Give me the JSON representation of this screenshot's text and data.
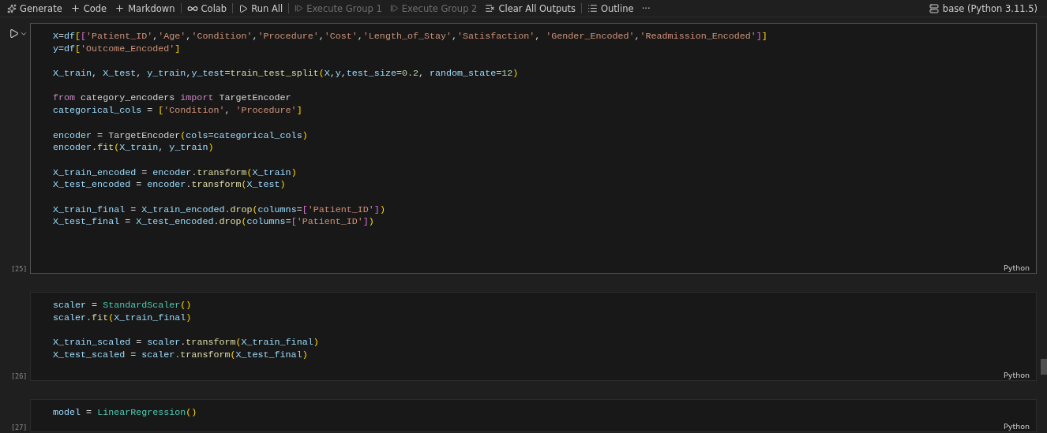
{
  "toolbar": {
    "items": [
      {
        "label": "Generate",
        "disabled": false,
        "separator_before": false
      },
      {
        "label": "Code",
        "disabled": false,
        "separator_before": false
      },
      {
        "label": "Markdown",
        "disabled": false,
        "separator_before": false
      },
      {
        "label": "Colab",
        "disabled": false,
        "separator_before": true
      },
      {
        "label": "Run All",
        "disabled": false,
        "separator_before": true
      },
      {
        "label": "Execute Group 1",
        "disabled": true,
        "separator_before": true
      },
      {
        "label": "Execute Group 2",
        "disabled": true,
        "separator_before": false
      },
      {
        "label": "Clear All Outputs",
        "disabled": false,
        "separator_before": false
      },
      {
        "label": "Outline",
        "disabled": false,
        "separator_before": true
      },
      {
        "label": "···",
        "disabled": false,
        "separator_before": false
      }
    ],
    "kernel": "base (Python 3.11.5)"
  },
  "cells": [
    {
      "focused": true,
      "execution_count": "[25]",
      "language": "Python",
      "blocks": [
        [
          [
            {
              "kind": "var",
              "text": "X"
            },
            {
              "kind": "op",
              "text": "="
            },
            {
              "kind": "var",
              "text": "df"
            },
            {
              "kind": "b1",
              "text": "["
            },
            {
              "kind": "b2",
              "text": "["
            },
            {
              "kind": "str",
              "text": "'Patient_ID'"
            },
            {
              "kind": "op",
              "text": ","
            },
            {
              "kind": "str",
              "text": "'Age'"
            },
            {
              "kind": "op",
              "text": ","
            },
            {
              "kind": "str",
              "text": "'Condition'"
            },
            {
              "kind": "op",
              "text": ","
            },
            {
              "kind": "str",
              "text": "'Procedure'"
            },
            {
              "kind": "op",
              "text": ","
            },
            {
              "kind": "str",
              "text": "'Cost'"
            },
            {
              "kind": "op",
              "text": ","
            },
            {
              "kind": "str",
              "text": "'Length_of_Stay'"
            },
            {
              "kind": "op",
              "text": ","
            },
            {
              "kind": "str",
              "text": "'Satisfaction'"
            },
            {
              "kind": "op",
              "text": ", "
            },
            {
              "kind": "str",
              "text": "'Gender_Encoded'"
            },
            {
              "kind": "op",
              "text": ","
            },
            {
              "kind": "str",
              "text": "'Readmission_Encoded'"
            },
            {
              "kind": "b2",
              "text": "]"
            },
            {
              "kind": "b1",
              "text": "]"
            }
          ],
          [
            {
              "kind": "var",
              "text": "y"
            },
            {
              "kind": "op",
              "text": "="
            },
            {
              "kind": "var",
              "text": "df"
            },
            {
              "kind": "b1",
              "text": "["
            },
            {
              "kind": "str",
              "text": "'Outcome_Encoded'"
            },
            {
              "kind": "b1",
              "text": "]"
            }
          ]
        ],
        [
          [
            {
              "kind": "var",
              "text": "X_train"
            },
            {
              "kind": "op",
              "text": ", "
            },
            {
              "kind": "var",
              "text": "X_test"
            },
            {
              "kind": "op",
              "text": ", "
            },
            {
              "kind": "var",
              "text": "y_train"
            },
            {
              "kind": "op",
              "text": ","
            },
            {
              "kind": "var",
              "text": "y_test"
            },
            {
              "kind": "op",
              "text": "="
            },
            {
              "kind": "func",
              "text": "train_test_split"
            },
            {
              "kind": "b1",
              "text": "("
            },
            {
              "kind": "var",
              "text": "X"
            },
            {
              "kind": "op",
              "text": ","
            },
            {
              "kind": "var",
              "text": "y"
            },
            {
              "kind": "op",
              "text": ","
            },
            {
              "kind": "var",
              "text": "test_size"
            },
            {
              "kind": "op",
              "text": "="
            },
            {
              "kind": "num",
              "text": "0.2"
            },
            {
              "kind": "op",
              "text": ", "
            },
            {
              "kind": "var",
              "text": "random_state"
            },
            {
              "kind": "op",
              "text": "="
            },
            {
              "kind": "num",
              "text": "12"
            },
            {
              "kind": "b1",
              "text": ")"
            }
          ]
        ],
        [
          [
            {
              "kind": "kw",
              "text": "from"
            },
            {
              "kind": "op",
              "text": " category_encoders "
            },
            {
              "kind": "kw",
              "text": "import"
            },
            {
              "kind": "op",
              "text": " TargetEncoder"
            }
          ],
          [
            {
              "kind": "var",
              "text": "categorical_cols"
            },
            {
              "kind": "op",
              "text": " = "
            },
            {
              "kind": "b1",
              "text": "["
            },
            {
              "kind": "str",
              "text": "'Condition'"
            },
            {
              "kind": "op",
              "text": ", "
            },
            {
              "kind": "str",
              "text": "'Procedure'"
            },
            {
              "kind": "b1",
              "text": "]"
            }
          ]
        ],
        [
          [
            {
              "kind": "var",
              "text": "encoder"
            },
            {
              "kind": "op",
              "text": " = TargetEncoder"
            },
            {
              "kind": "b1",
              "text": "("
            },
            {
              "kind": "var",
              "text": "cols"
            },
            {
              "kind": "op",
              "text": "="
            },
            {
              "kind": "var",
              "text": "categorical_cols"
            },
            {
              "kind": "b1",
              "text": ")"
            }
          ],
          [
            {
              "kind": "var",
              "text": "encoder"
            },
            {
              "kind": "op",
              "text": "."
            },
            {
              "kind": "func",
              "text": "fit"
            },
            {
              "kind": "b1",
              "text": "("
            },
            {
              "kind": "var",
              "text": "X_train"
            },
            {
              "kind": "op",
              "text": ", "
            },
            {
              "kind": "var",
              "text": "y_train"
            },
            {
              "kind": "b1",
              "text": ")"
            }
          ]
        ],
        [
          [
            {
              "kind": "var",
              "text": "X_train_encoded"
            },
            {
              "kind": "op",
              "text": " = "
            },
            {
              "kind": "var",
              "text": "encoder"
            },
            {
              "kind": "op",
              "text": "."
            },
            {
              "kind": "func",
              "text": "transform"
            },
            {
              "kind": "b1",
              "text": "("
            },
            {
              "kind": "var",
              "text": "X_train"
            },
            {
              "kind": "b1",
              "text": ")"
            }
          ],
          [
            {
              "kind": "var",
              "text": "X_test_encoded"
            },
            {
              "kind": "op",
              "text": " = "
            },
            {
              "kind": "var",
              "text": "encoder"
            },
            {
              "kind": "op",
              "text": "."
            },
            {
              "kind": "func",
              "text": "transform"
            },
            {
              "kind": "b1",
              "text": "("
            },
            {
              "kind": "var",
              "text": "X_test"
            },
            {
              "kind": "b1",
              "text": ")"
            }
          ]
        ],
        [
          [
            {
              "kind": "var",
              "text": "X_train_final"
            },
            {
              "kind": "op",
              "text": " = "
            },
            {
              "kind": "var",
              "text": "X_train_encoded"
            },
            {
              "kind": "op",
              "text": "."
            },
            {
              "kind": "func",
              "text": "drop"
            },
            {
              "kind": "b1",
              "text": "("
            },
            {
              "kind": "var",
              "text": "columns"
            },
            {
              "kind": "op",
              "text": "="
            },
            {
              "kind": "b2",
              "text": "["
            },
            {
              "kind": "str",
              "text": "'Patient_ID'"
            },
            {
              "kind": "b2",
              "text": "]"
            },
            {
              "kind": "b1",
              "text": ")"
            }
          ],
          [
            {
              "kind": "var",
              "text": "X_test_final"
            },
            {
              "kind": "op",
              "text": " = "
            },
            {
              "kind": "var",
              "text": "X_test_encoded"
            },
            {
              "kind": "op",
              "text": "."
            },
            {
              "kind": "func",
              "text": "drop"
            },
            {
              "kind": "b1",
              "text": "("
            },
            {
              "kind": "var",
              "text": "columns"
            },
            {
              "kind": "op",
              "text": "="
            },
            {
              "kind": "b2",
              "text": "["
            },
            {
              "kind": "str",
              "text": "'Patient_ID'"
            },
            {
              "kind": "b2",
              "text": "]"
            },
            {
              "kind": "b1",
              "text": ")"
            }
          ]
        ]
      ]
    },
    {
      "focused": false,
      "execution_count": "[26]",
      "language": "Python",
      "blocks": [
        [
          [
            {
              "kind": "var",
              "text": "scaler"
            },
            {
              "kind": "op",
              "text": " = "
            },
            {
              "kind": "cls",
              "text": "StandardScaler"
            },
            {
              "kind": "b1",
              "text": "()"
            }
          ],
          [
            {
              "kind": "var",
              "text": "scaler"
            },
            {
              "kind": "op",
              "text": "."
            },
            {
              "kind": "func",
              "text": "fit"
            },
            {
              "kind": "b1",
              "text": "("
            },
            {
              "kind": "var",
              "text": "X_train_final"
            },
            {
              "kind": "b1",
              "text": ")"
            }
          ]
        ],
        [
          [
            {
              "kind": "var",
              "text": "X_train_scaled"
            },
            {
              "kind": "op",
              "text": " = "
            },
            {
              "kind": "var",
              "text": "scaler"
            },
            {
              "kind": "op",
              "text": "."
            },
            {
              "kind": "func",
              "text": "transform"
            },
            {
              "kind": "b1",
              "text": "("
            },
            {
              "kind": "var",
              "text": "X_train_final"
            },
            {
              "kind": "b1",
              "text": ")"
            }
          ],
          [
            {
              "kind": "var",
              "text": "X_test_scaled"
            },
            {
              "kind": "op",
              "text": " = "
            },
            {
              "kind": "var",
              "text": "scaler"
            },
            {
              "kind": "op",
              "text": "."
            },
            {
              "kind": "func",
              "text": "transform"
            },
            {
              "kind": "b1",
              "text": "("
            },
            {
              "kind": "var",
              "text": "X_test_final"
            },
            {
              "kind": "b1",
              "text": ")"
            }
          ]
        ]
      ]
    },
    {
      "focused": false,
      "execution_count": "[27]",
      "language": "Python",
      "blocks": [
        [
          [
            {
              "kind": "var",
              "text": "model"
            },
            {
              "kind": "op",
              "text": " = "
            },
            {
              "kind": "cls",
              "text": "LinearRegression"
            },
            {
              "kind": "b1",
              "text": "()"
            }
          ]
        ]
      ]
    }
  ]
}
